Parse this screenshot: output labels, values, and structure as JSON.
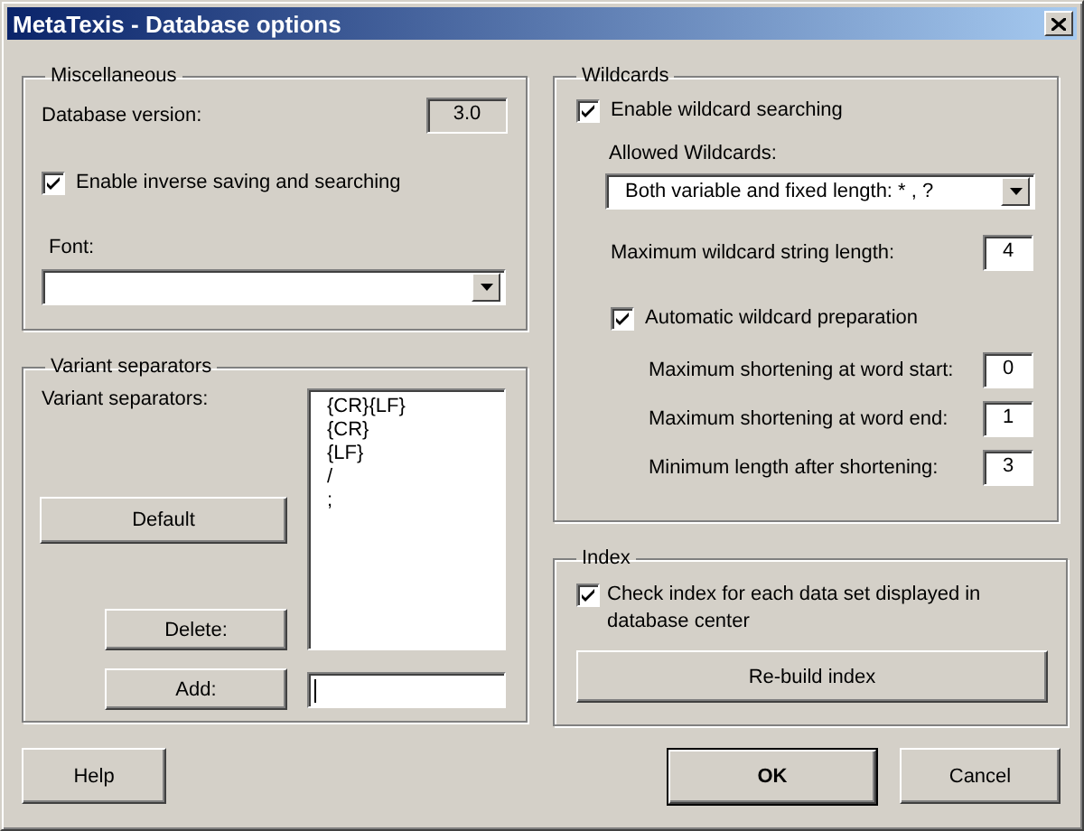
{
  "window": {
    "title": "MetaTexis - Database options"
  },
  "miscellaneous": {
    "title": "Miscellaneous",
    "version_label": "Database version:",
    "version": "3.0",
    "inverse": {
      "label": "Enable inverse saving and searching",
      "checked": true
    },
    "font_label": "Font:"
  },
  "variant_separators": {
    "title": "Variant separators",
    "label": "Variant separators:",
    "items": [
      "{CR}{LF}",
      "{CR}",
      "{LF}",
      "/",
      ";"
    ],
    "default_button": "Default",
    "delete_button": "Delete:",
    "add_button": "Add:"
  },
  "wildcards": {
    "title": "Wildcards",
    "enable": {
      "label": "Enable wildcard searching",
      "checked": true
    },
    "allowed_label": "Allowed Wildcards:",
    "allowed_value": "Both variable and fixed length: * , ?",
    "max_length": {
      "label": "Maximum wildcard string length:",
      "value": "4"
    },
    "auto": {
      "label": "Automatic wildcard preparation",
      "checked": true
    },
    "settings": [
      {
        "label": "Maximum shortening at word start:",
        "value": "0"
      },
      {
        "label": "Maximum shortening at word end:",
        "value": "1"
      },
      {
        "label": "Minimum length after shortening:",
        "value": "3"
      }
    ]
  },
  "index": {
    "title": "Index",
    "check": {
      "label": "Check index for each data set displayed in database center",
      "checked": true
    },
    "rebuild_button": "Re-build index"
  },
  "footer": {
    "help": "Help",
    "ok": "OK",
    "cancel": "Cancel"
  }
}
